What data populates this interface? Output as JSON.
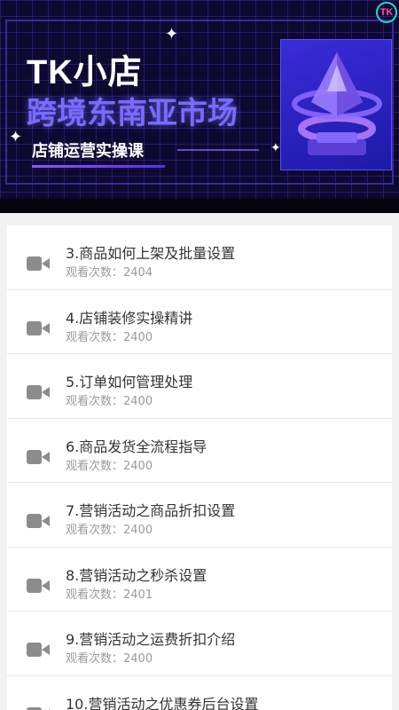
{
  "banner": {
    "title_line1": "TK小店",
    "title_line2": "跨境东南亚市场",
    "subtitle": "店铺运营实操课",
    "logo_text": "TK"
  },
  "lessons": [
    {
      "title": "3.商品如何上架及批量设置",
      "views_label": "观看次数：",
      "views": "2404"
    },
    {
      "title": "4.店铺装修实操精讲",
      "views_label": "观看次数：",
      "views": "2400"
    },
    {
      "title": "5.订单如何管理处理",
      "views_label": "观看次数：",
      "views": "2400"
    },
    {
      "title": "6.商品发货全流程指导",
      "views_label": "观看次数：",
      "views": "2400"
    },
    {
      "title": "7.营销活动之商品折扣设置",
      "views_label": "观看次数：",
      "views": "2400"
    },
    {
      "title": "8.营销活动之秒杀设置",
      "views_label": "观看次数：",
      "views": "2401"
    },
    {
      "title": "9.营销活动之运费折扣介绍",
      "views_label": "观看次数：",
      "views": "2400"
    },
    {
      "title": "10.营销活动之优惠券后台设置",
      "views_label": "",
      "views": ""
    }
  ],
  "colors": {
    "banner_bg": "#0d0930",
    "accent_purple": "#7a6bff",
    "icon_gray": "#8c8c8c"
  }
}
